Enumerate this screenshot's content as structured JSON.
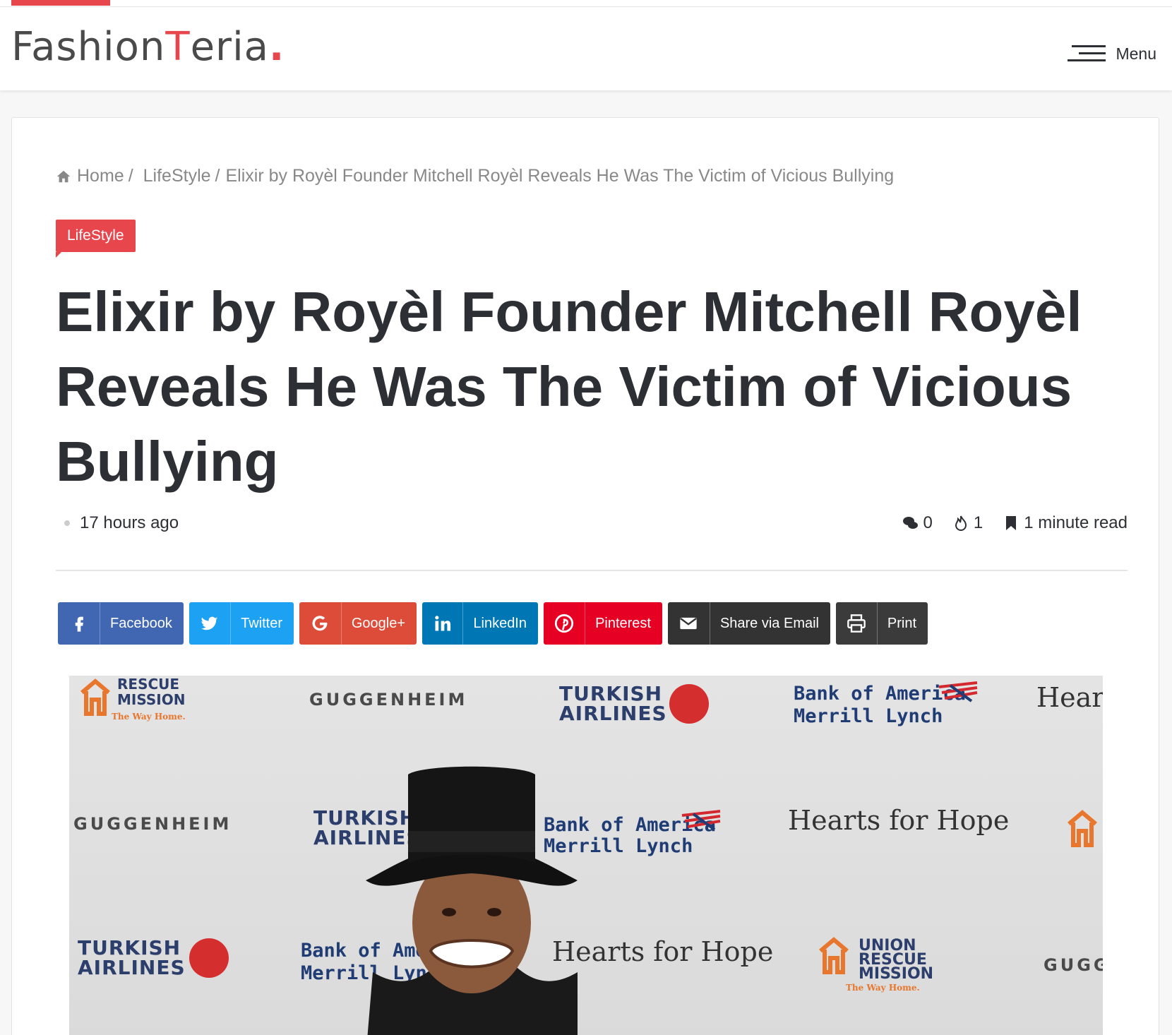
{
  "header": {
    "logo_part1": "Fashion",
    "logo_part2": "T",
    "logo_part3": "eria",
    "logo_dot": ".",
    "menu_label": "Menu"
  },
  "breadcrumb": {
    "home": "Home",
    "sep": "/",
    "category": "LifeStyle",
    "current": "Elixir by Royèl Founder Mitchell Royèl Reveals He Was The Victim of Vicious Bullying"
  },
  "article": {
    "category_tag": "LifeStyle",
    "title": "Elixir by Royèl Founder Mitchell Royèl Reveals He Was The Victim of Vicious Bullying",
    "time_ago": "17 hours ago",
    "comments": "0",
    "views": "1",
    "read_time": "1 minute read"
  },
  "share": {
    "facebook": "Facebook",
    "twitter": "Twitter",
    "googleplus": "Google+",
    "linkedin": "LinkedIn",
    "pinterest": "Pinterest",
    "email": "Share via Email",
    "print": "Print"
  },
  "photo_backdrop": {
    "guggenheim": "GUGGENHEIM",
    "turkish_1": "TURKISH",
    "turkish_2": "AIRLINES",
    "boa_1": "Bank of America",
    "boa_2": "Merrill Lynch",
    "hearts": "Hearts for Hope",
    "urm_1": "UNION",
    "urm_2": "RESCUE",
    "urm_3": "MISSION",
    "urm_4": "The Way Home.",
    "hearts_cut": "Heart",
    "gugg_cut": "GUGG"
  },
  "colors": {
    "accent": "#e8464d",
    "facebook": "#4267b2",
    "twitter": "#1da1f2",
    "googleplus": "#dd4b39",
    "linkedin": "#0077b5",
    "pinterest": "#e60023",
    "email": "#333333",
    "print": "#3b3b3b"
  }
}
